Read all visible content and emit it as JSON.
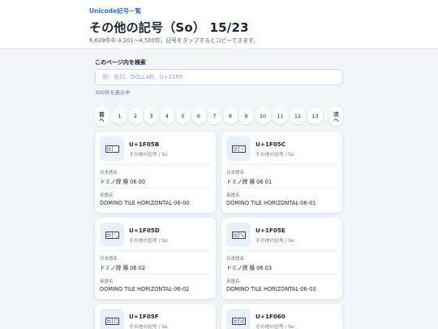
{
  "header": {
    "breadcrumb": "Unicode記号一覧",
    "title": "その他の記号（So） 15/23",
    "subtitle": "6,639件中 4,201〜4,500件。記号をタップするとコピーできます。"
  },
  "search": {
    "label": "このページ内を検索",
    "placeholder": "例：矢印、DOLLAR、U+2190",
    "count": "300件を表示中"
  },
  "pager": {
    "prev_label": "前",
    "prev_arrow": "へ",
    "next_label": "次",
    "next_arrow": "へ",
    "pages": [
      "1",
      "2",
      "3",
      "4",
      "5",
      "6",
      "7",
      "8",
      "9",
      "10",
      "11",
      "12",
      "13",
      "1"
    ]
  },
  "field_labels": {
    "japanese": "日本語名",
    "english": "英語名"
  },
  "cards": [
    {
      "code": "U+1F05B",
      "category": "その他の記号 / So",
      "jp_name": "ドミノ牌 横 06 00",
      "en_name": "DOMINO TILE HORIZONTAL-06-00",
      "dots": 6,
      "dots_right": 0
    },
    {
      "code": "U+1F05C",
      "category": "その他の記号 / So",
      "jp_name": "ドミノ牌 横 06 01",
      "en_name": "DOMINO TILE HORIZONTAL-06-01",
      "dots": 6,
      "dots_right": 1
    },
    {
      "code": "U+1F05D",
      "category": "その他の記号 / So",
      "jp_name": "ドミノ牌 横 06 02",
      "en_name": "DOMINO TILE HORIZONTAL-06-02",
      "dots": 6,
      "dots_right": 2
    },
    {
      "code": "U+1F05E",
      "category": "その他の記号 / So",
      "jp_name": "ドミノ牌 横 06 03",
      "en_name": "DOMINO TILE HORIZONTAL-06-03",
      "dots": 6,
      "dots_right": 3
    },
    {
      "code": "U+1F05F",
      "category": "その他の記号 / So",
      "jp_name": "ドミノ牌 横 06 04",
      "en_name": "DOMINO TILE HORIZONTAL-06-04",
      "dots": 6,
      "dots_right": 4
    },
    {
      "code": "U+1F060",
      "category": "その他の記号 / So",
      "jp_name": "ドミノ牌 横 06 05",
      "en_name": "DOMINO TILE HORIZONTAL-06-05",
      "dots": 6,
      "dots_right": 5
    }
  ],
  "colors": {
    "accent": "#2f6fd6",
    "tile_bg": "#eaf0fb",
    "page_bg": "#f3f5f8"
  }
}
